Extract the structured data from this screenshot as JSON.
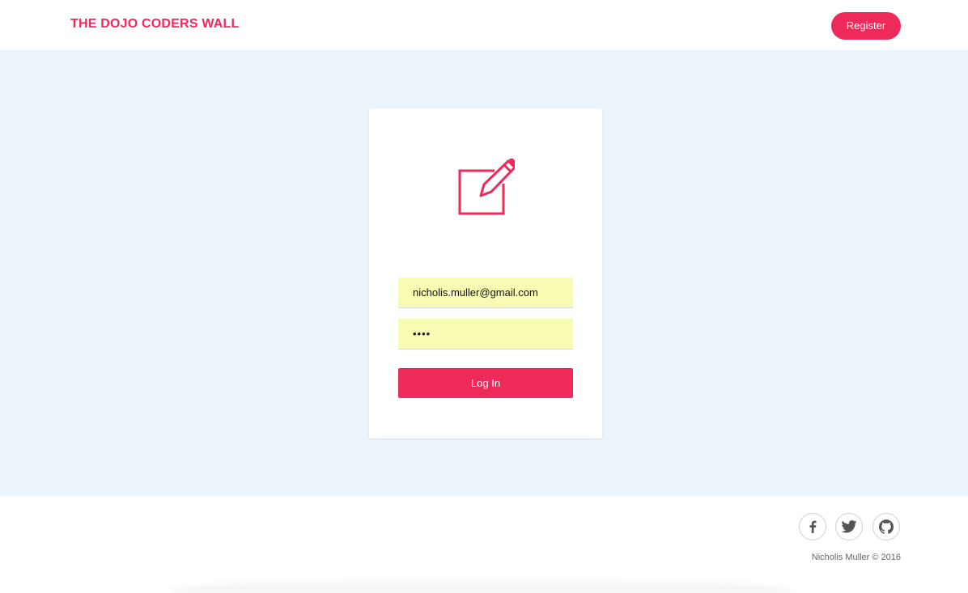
{
  "header": {
    "brand": "THE DOJO CODERS WALL",
    "register_label": "Register"
  },
  "login_card": {
    "icon": "edit-icon",
    "email_value": "nicholis.muller@gmail.com",
    "password_value": "••••",
    "login_label": "Log In"
  },
  "footer": {
    "social_icons": [
      "facebook-icon",
      "twitter-icon",
      "github-icon"
    ],
    "copyright": "Nicholis Muller © 2016"
  },
  "colors": {
    "accent": "#ee2a5a",
    "main_bg": "#ebf3fb",
    "autofill_bg": "#f8fbb3"
  }
}
